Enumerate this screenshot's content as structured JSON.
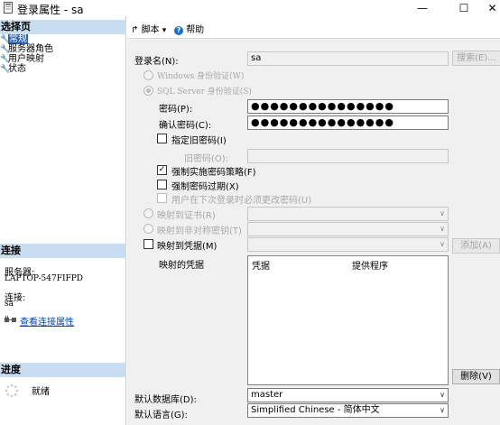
{
  "window": {
    "title": "登录属性 - sa",
    "minimize": "—",
    "maximize": "☐",
    "close": "✕"
  },
  "left": {
    "select_page_title": "选择页",
    "pages": [
      "常规",
      "服务器角色",
      "用户映射",
      "状态"
    ],
    "connection_title": "连接",
    "server_label": "服务器:",
    "server_value": "LAPTOP-547FIFPD",
    "conn_label": "连接:",
    "conn_value": "sa",
    "view_conn_props": "查看连接属性",
    "progress_title": "进度",
    "progress_status": "就绪"
  },
  "toolbar": {
    "script": "脚本",
    "script_arrow": "▾",
    "help": "帮助"
  },
  "form": {
    "login_name_label": "登录名(N):",
    "login_name_value": "sa",
    "search_button": "搜索(E)...",
    "windows_auth": "Windows 身份验证(W)",
    "sql_auth": "SQL Server 身份验证(S)",
    "password_label": "密码(P):",
    "password_value": "●●●●●●●●●●●●●●●",
    "confirm_label": "确认密码(C):",
    "confirm_value": "●●●●●●●●●●●●●●●",
    "specify_old": "指定旧密码(I)",
    "old_password_label": "旧密码(O):",
    "enforce_policy": "强制实施密码策略(F)",
    "enforce_expiration": "强制密码过期(X)",
    "must_change": "用户在下次登录时必须更改密码(U)",
    "map_cert": "映射到证书(R)",
    "map_asym": "映射到非对称密钥(T)",
    "map_cred": "映射到凭据(M)",
    "add_button": "添加(A)",
    "mapped_creds_label": "映射的凭据",
    "col_credential": "凭据",
    "col_provider": "提供程序",
    "remove_button": "删除(V)",
    "default_db_label": "默认数据库(D):",
    "default_db_value": "master",
    "default_lang_label": "默认语言(G):",
    "default_lang_value": "Simplified Chinese - 简体中文"
  },
  "colors": {
    "section_header": "#c9ddf1",
    "selected": "#3063b0",
    "link": "#0645ad",
    "panel": "#f0f0f0"
  }
}
